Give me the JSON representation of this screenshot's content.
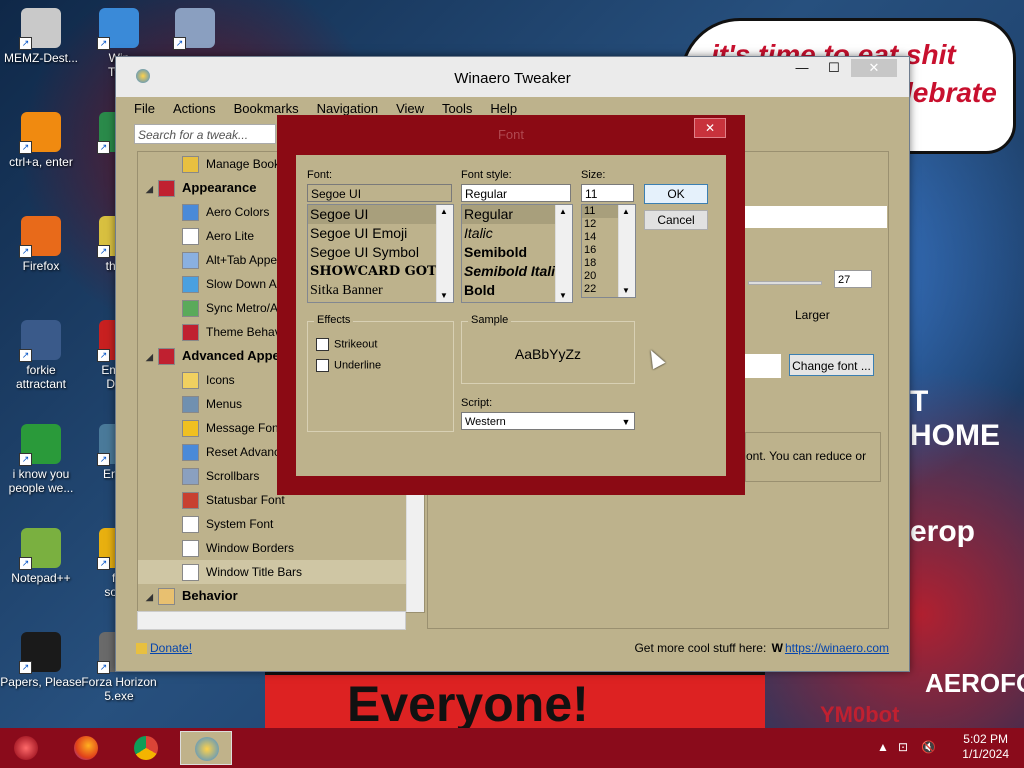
{
  "wallpaper": {
    "speech_line1": "it's time to eat shit",
    "speech_line2": "lebrate",
    "banner_text": "Everyone!",
    "side_text_1": "T HOME",
    "side_text_2": "erop",
    "side_text_3": "AEROFOS",
    "side_text_4": "YM0bot"
  },
  "desktop_icons": [
    {
      "label": "MEMZ-Dest...",
      "color": "#c9c9c9"
    },
    {
      "label": "Win\nTwe",
      "color": "#3a8ad8"
    },
    {
      "label": "",
      "color": "#8a9fc0"
    },
    {
      "label": "ctrl+a, enter",
      "color": "#f08a10"
    },
    {
      "label": "x",
      "color": "#2a8a4a"
    },
    {
      "label": "Firefox",
      "color": "#e86a1a"
    },
    {
      "label": "the p\nsl",
      "color": "#d8c040"
    },
    {
      "label": "forkie\nattractant",
      "color": "#3a5a8a"
    },
    {
      "label": "Embar\nDev-",
      "color": "#c82020"
    },
    {
      "label": "i know you\npeople we...",
      "color": "#2a9a3a"
    },
    {
      "label": "Ender",
      "color": "#4a7a9a"
    },
    {
      "label": "Notepad++",
      "color": "#7ab040"
    },
    {
      "label": "for\nsome",
      "color": "#e8b010"
    },
    {
      "label": "Papers, Please",
      "color": "#1a1a1a"
    },
    {
      "label": "Forza Horizon\n5.exe",
      "color": "#6a6a6a"
    }
  ],
  "window": {
    "title": "Winaero Tweaker",
    "min": "—",
    "max": "☐",
    "close": "✕",
    "menu": [
      "File",
      "Actions",
      "Bookmarks",
      "Navigation",
      "View",
      "Tools",
      "Help"
    ],
    "search_placeholder": "Search for a tweak...",
    "defaults_label": "aults",
    "spin_value": "27",
    "larger_label": "Larger",
    "change_font_label": "Change font ...",
    "desc_text": "ont. You can reduce or",
    "donate": "Donate!",
    "get_more": "Get more cool stuff here:",
    "winaero_w": "W",
    "winaero_link": "https://winaero.com"
  },
  "tree": [
    {
      "type": "item",
      "label": "Manage Bookm",
      "icon_color": "#e8c040"
    },
    {
      "type": "cat",
      "label": "Appearance",
      "icon_color": "#c02030"
    },
    {
      "type": "item",
      "label": "Aero Colors",
      "icon_color": "#4a8ad8"
    },
    {
      "type": "item",
      "label": "Aero Lite",
      "icon_color": "#ffffff"
    },
    {
      "type": "item",
      "label": "Alt+Tab Appear",
      "icon_color": "#8ab0e0"
    },
    {
      "type": "item",
      "label": "Slow Down Anim",
      "icon_color": "#4aa0e0"
    },
    {
      "type": "item",
      "label": "Sync Metro/Aer",
      "icon_color": "#5aaa5a"
    },
    {
      "type": "item",
      "label": "Theme Behavior",
      "icon_color": "#c02030"
    },
    {
      "type": "cat",
      "label": "Advanced Appea",
      "icon_color": "#c02030"
    },
    {
      "type": "item",
      "label": "Icons",
      "icon_color": "#f0d060"
    },
    {
      "type": "item",
      "label": "Menus",
      "icon_color": "#7090b0"
    },
    {
      "type": "item",
      "label": "Message Font",
      "icon_color": "#f0c020"
    },
    {
      "type": "item",
      "label": "Reset Advance",
      "icon_color": "#4a8ad8"
    },
    {
      "type": "item",
      "label": "Scrollbars",
      "icon_color": "#8aa0c0"
    },
    {
      "type": "item",
      "label": "Statusbar Font",
      "icon_color": "#c84030"
    },
    {
      "type": "item",
      "label": "System Font",
      "icon_color": "#ffffff"
    },
    {
      "type": "item",
      "label": "Window Borders",
      "icon_color": "#ffffff"
    },
    {
      "type": "item",
      "label": "Window Title Bars",
      "icon_color": "#ffffff"
    },
    {
      "type": "cat",
      "label": "Behavior",
      "icon_color": "#e8c070"
    }
  ],
  "dialog": {
    "title": "Font",
    "close": "✕",
    "font_label": "Font:",
    "font_value": "Segoe UI",
    "fonts": [
      "Segoe UI",
      "Segoe UI Emoji",
      "Segoe UI Symbol",
      "SHOWCARD GOTHI",
      "Sitka Banner"
    ],
    "style_label": "Font style:",
    "style_value": "Regular",
    "styles": [
      "Regular",
      "Italic",
      "Semibold",
      "Semibold Italic",
      "Bold"
    ],
    "size_label": "Size:",
    "size_value": "11",
    "sizes": [
      "11",
      "12",
      "14",
      "16",
      "18",
      "20",
      "22"
    ],
    "ok": "OK",
    "cancel": "Cancel",
    "effects_label": "Effects",
    "strikeout": "Strikeout",
    "underline": "Underline",
    "sample_label": "Sample",
    "sample_text": "AaBbYyZz",
    "script_label": "Script:",
    "script_value": "Western"
  },
  "taskbar": {
    "apps": [
      {
        "name": "start",
        "color": "#c02030"
      },
      {
        "name": "firefox",
        "color": "#e86a1a"
      },
      {
        "name": "chrome",
        "color": "#2a9a3a"
      },
      {
        "name": "winaero",
        "color": "#3a8ad8"
      }
    ],
    "time": "5:02 PM",
    "date": "1/1/2024"
  }
}
